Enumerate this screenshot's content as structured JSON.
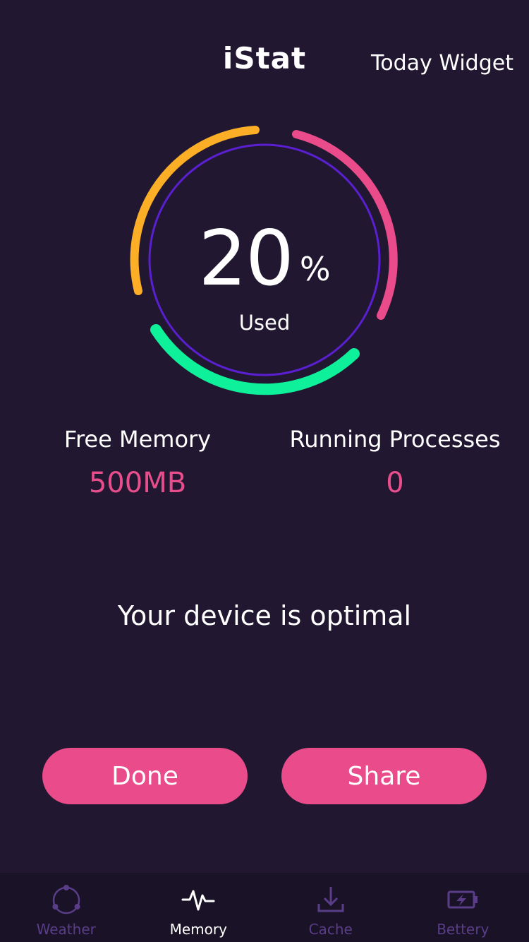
{
  "header": {
    "title": "iStat",
    "widget_link": "Today Widget"
  },
  "gauge": {
    "value": "20",
    "unit": "%",
    "label": "Used",
    "used_fraction": 0.2,
    "colors": {
      "orange": "#fbae26",
      "pink": "#ea4c8b",
      "green": "#0ff09a",
      "inner_ring": "#5a1fd1"
    }
  },
  "stats": {
    "free_memory": {
      "label": "Free Memory",
      "value": "500MB"
    },
    "running_processes": {
      "label": "Running Processes",
      "value": "0"
    }
  },
  "status_message": "Your device is optimal",
  "buttons": {
    "done": "Done",
    "share": "Share"
  },
  "tabs": [
    {
      "label": "Weather",
      "icon": "weather-icon",
      "active": false
    },
    {
      "label": "Memory",
      "icon": "pulse-icon",
      "active": true
    },
    {
      "label": "Cache",
      "icon": "download-icon",
      "active": false
    },
    {
      "label": "Bettery",
      "icon": "battery-icon",
      "active": false
    }
  ],
  "colors": {
    "background": "#211730",
    "accent": "#ea4c8b",
    "tab_inactive": "#5a3d88"
  }
}
